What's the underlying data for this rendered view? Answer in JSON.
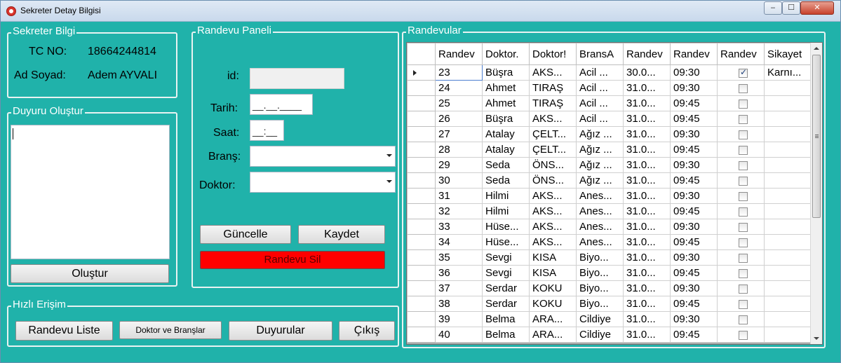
{
  "window": {
    "title": "Sekreter Detay Bilgisi",
    "min": "‒",
    "max": "☐",
    "close": "✕"
  },
  "sekreter": {
    "legend": "Sekreter Bilgi",
    "tc_label": "TC NO:",
    "tc_value": "18664244814",
    "name_label": "Ad Soyad:",
    "name_value": "Adem AYVALI"
  },
  "duyuru": {
    "legend": "Duyuru Oluştur",
    "text": "",
    "button": "Oluştur"
  },
  "hizli": {
    "legend": "Hızlı Erişim",
    "buttons": [
      "Randevu Liste",
      "Doktor ve Branşlar",
      "Duyurular",
      "Çıkış"
    ]
  },
  "panel": {
    "legend": "Randevu Paneli",
    "id_label": "id:",
    "id_value": "",
    "tarih_label": "Tarih:",
    "tarih_value": "__.__.____",
    "saat_label": "Saat:",
    "saat_value": "__:__",
    "brans_label": "Branş:",
    "brans_value": "",
    "doktor_label": "Doktor:",
    "doktor_value": "",
    "guncelle": "Güncelle",
    "kaydet": "Kaydet",
    "sil": "Randevu Sil"
  },
  "randevular": {
    "legend": "Randevular",
    "columns": [
      "Randev",
      "Doktor.",
      "Doktor!",
      "BransA",
      "Randev",
      "Randev",
      "Randev",
      "Sikayet"
    ],
    "rows": [
      {
        "id": "23",
        "ad": "Büşra",
        "soyad": "AKS...",
        "brans": "Acil ...",
        "tarih": "30.0...",
        "saat": "09:30",
        "durum": true,
        "sikayet": "Karnı..."
      },
      {
        "id": "24",
        "ad": "Ahmet",
        "soyad": "TIRAŞ",
        "brans": "Acil ...",
        "tarih": "31.0...",
        "saat": "09:30",
        "durum": false,
        "sikayet": ""
      },
      {
        "id": "25",
        "ad": "Ahmet",
        "soyad": "TIRAŞ",
        "brans": "Acil ...",
        "tarih": "31.0...",
        "saat": "09:45",
        "durum": false,
        "sikayet": ""
      },
      {
        "id": "26",
        "ad": "Büşra",
        "soyad": "AKS...",
        "brans": "Acil ...",
        "tarih": "31.0...",
        "saat": "09:45",
        "durum": false,
        "sikayet": ""
      },
      {
        "id": "27",
        "ad": "Atalay",
        "soyad": "ÇELT...",
        "brans": "Ağız ...",
        "tarih": "31.0...",
        "saat": "09:30",
        "durum": false,
        "sikayet": ""
      },
      {
        "id": "28",
        "ad": "Atalay",
        "soyad": "ÇELT...",
        "brans": "Ağız ...",
        "tarih": "31.0...",
        "saat": "09:45",
        "durum": false,
        "sikayet": ""
      },
      {
        "id": "29",
        "ad": "Seda",
        "soyad": "ÖNS...",
        "brans": "Ağız ...",
        "tarih": "31.0...",
        "saat": "09:30",
        "durum": false,
        "sikayet": ""
      },
      {
        "id": "30",
        "ad": "Seda",
        "soyad": "ÖNS...",
        "brans": "Ağız ...",
        "tarih": "31.0...",
        "saat": "09:45",
        "durum": false,
        "sikayet": ""
      },
      {
        "id": "31",
        "ad": "Hilmi",
        "soyad": "AKS...",
        "brans": "Anes...",
        "tarih": "31.0...",
        "saat": "09:30",
        "durum": false,
        "sikayet": ""
      },
      {
        "id": "32",
        "ad": "Hilmi",
        "soyad": "AKS...",
        "brans": "Anes...",
        "tarih": "31.0...",
        "saat": "09:45",
        "durum": false,
        "sikayet": ""
      },
      {
        "id": "33",
        "ad": "Hüse...",
        "soyad": "AKS...",
        "brans": "Anes...",
        "tarih": "31.0...",
        "saat": "09:30",
        "durum": false,
        "sikayet": ""
      },
      {
        "id": "34",
        "ad": "Hüse...",
        "soyad": "AKS...",
        "brans": "Anes...",
        "tarih": "31.0...",
        "saat": "09:45",
        "durum": false,
        "sikayet": ""
      },
      {
        "id": "35",
        "ad": "Sevgi",
        "soyad": "KISA",
        "brans": "Biyo...",
        "tarih": "31.0...",
        "saat": "09:30",
        "durum": false,
        "sikayet": ""
      },
      {
        "id": "36",
        "ad": "Sevgi",
        "soyad": "KISA",
        "brans": "Biyo...",
        "tarih": "31.0...",
        "saat": "09:45",
        "durum": false,
        "sikayet": ""
      },
      {
        "id": "37",
        "ad": "Serdar",
        "soyad": "KOKU",
        "brans": "Biyo...",
        "tarih": "31.0...",
        "saat": "09:30",
        "durum": false,
        "sikayet": ""
      },
      {
        "id": "38",
        "ad": "Serdar",
        "soyad": "KOKU",
        "brans": "Biyo...",
        "tarih": "31.0...",
        "saat": "09:45",
        "durum": false,
        "sikayet": ""
      },
      {
        "id": "39",
        "ad": "Belma",
        "soyad": "ARA...",
        "brans": "Cildiye",
        "tarih": "31.0...",
        "saat": "09:30",
        "durum": false,
        "sikayet": ""
      },
      {
        "id": "40",
        "ad": "Belma",
        "soyad": "ARA...",
        "brans": "Cildiye",
        "tarih": "31.0...",
        "saat": "09:45",
        "durum": false,
        "sikayet": ""
      }
    ]
  }
}
